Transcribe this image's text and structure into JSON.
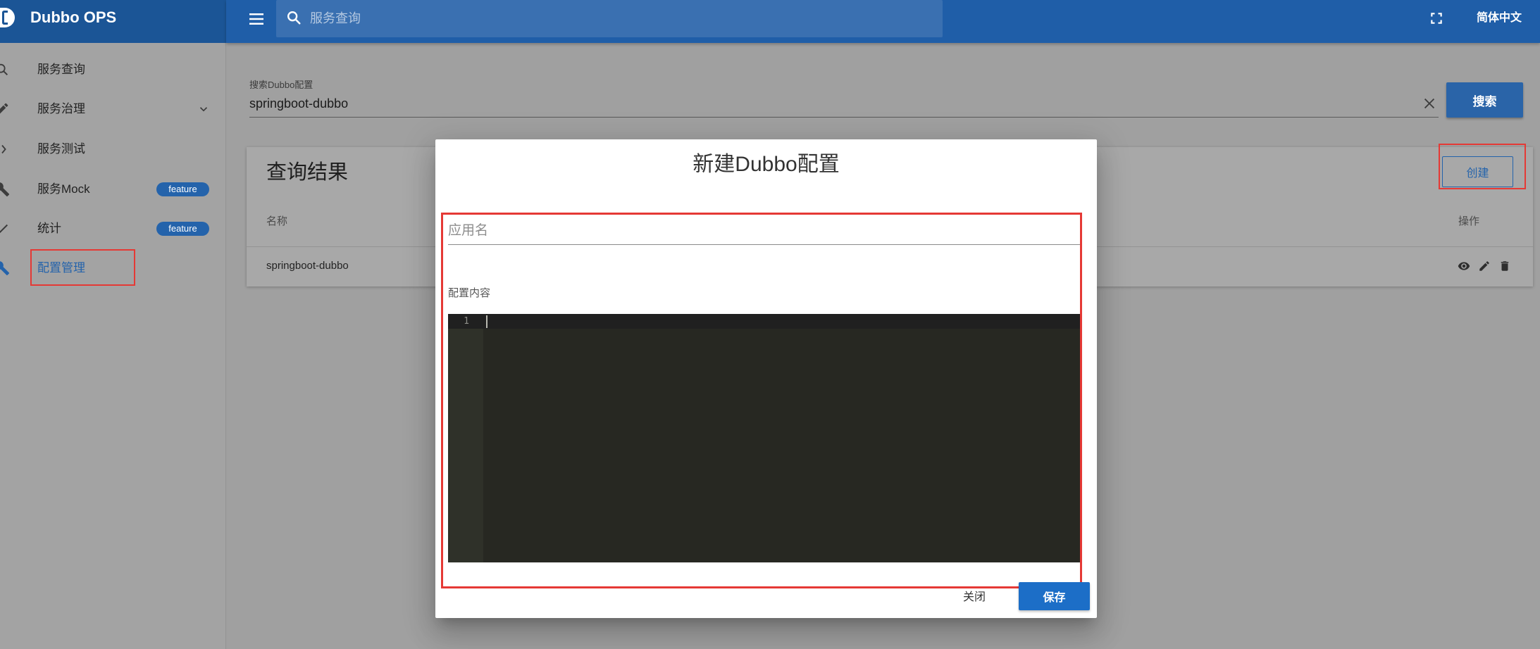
{
  "app": {
    "title": "Dubbo OPS",
    "language": "简体中文"
  },
  "topbar": {
    "search_placeholder": "服务查询"
  },
  "sidebar": {
    "items": [
      {
        "label": "服务查询",
        "icon": "search-icon"
      },
      {
        "label": "服务治理",
        "icon": "pencil-icon",
        "expandable": true
      },
      {
        "label": "服务测试",
        "icon": "chevron-right-icon"
      },
      {
        "label": "服务Mock",
        "icon": "wrench-icon",
        "badge": "feature"
      },
      {
        "label": "统计",
        "icon": "check-icon",
        "badge": "feature"
      },
      {
        "label": "配置管理",
        "icon": "wrench-icon",
        "active": true
      }
    ]
  },
  "main": {
    "search": {
      "label": "搜索Dubbo配置",
      "value": "springboot-dubbo",
      "button": "搜索"
    },
    "results": {
      "title": "查询结果",
      "create_button": "创建",
      "columns": [
        "名称",
        "操作"
      ],
      "rows": [
        {
          "name": "springboot-dubbo",
          "actions": [
            "eye-icon",
            "pencil-icon",
            "delete-icon"
          ]
        }
      ]
    }
  },
  "dialog": {
    "title": "新建Dubbo配置",
    "app_name_placeholder": "应用名",
    "content_label": "配置内容",
    "editor": {
      "line_numbers": [
        "1"
      ],
      "content": ""
    },
    "close_button": "关闭",
    "save_button": "保存"
  },
  "colors": {
    "app_bar": "#1f5ea8",
    "primary": "#2463ab",
    "save_button": "#1c6ec7",
    "highlight_box": "#e53935",
    "editor_background": "#272822"
  }
}
